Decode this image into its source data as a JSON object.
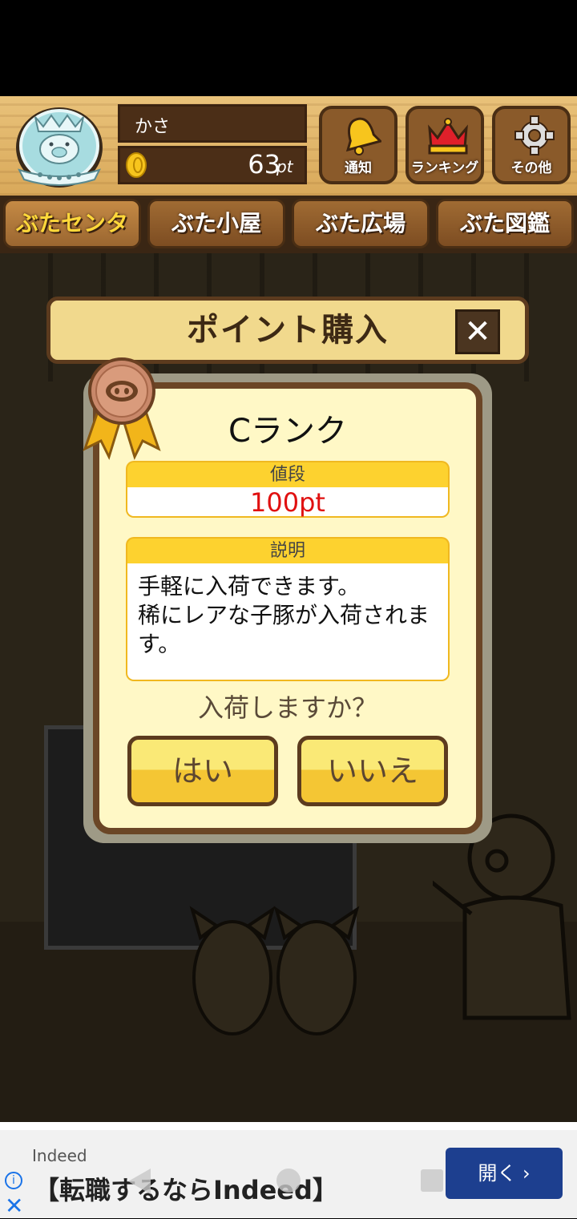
{
  "header": {
    "user_name": "かさ",
    "points_value": "63",
    "points_unit": "pt",
    "buttons": [
      {
        "label": "通知",
        "icon": "bell-icon"
      },
      {
        "label": "ランキング",
        "icon": "crown-icon"
      },
      {
        "label": "その他",
        "icon": "gear-icon"
      }
    ]
  },
  "tabs": [
    {
      "label": "ぶたセンター",
      "active": true
    },
    {
      "label": "ぶた小屋",
      "active": false
    },
    {
      "label": "ぶた広場",
      "active": false
    },
    {
      "label": "ぶた図鑑",
      "active": false
    }
  ],
  "modal": {
    "title": "ポイント購入",
    "rank": "Cランク",
    "price_label": "値段",
    "price_value": "100pt",
    "desc_label": "説明",
    "description": "手軽に入荷できます。\n稀にレアな子豚が入荷されます。",
    "question": "入荷しますか？",
    "yes_label": "はい",
    "no_label": "いいえ"
  },
  "ad": {
    "brand": "Indeed",
    "headline": "【転職するならIndeed】",
    "open_label": "開く ›"
  },
  "colors": {
    "wood": "#d9a95a",
    "dark_wood": "#4b2e17",
    "panel": "#fff8c6",
    "section_header": "#fdd22f",
    "price_text": "#e01010",
    "button_yellow": "#f4c634",
    "ad_button": "#1d3f8f"
  }
}
